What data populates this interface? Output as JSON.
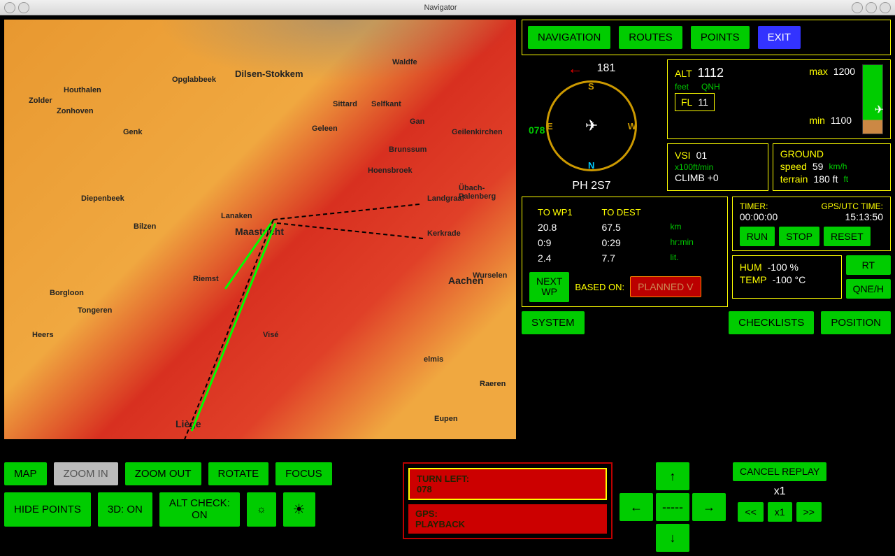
{
  "window": {
    "title": "Navigator"
  },
  "top_nav": {
    "navigation": "NAVIGATION",
    "routes": "ROUTES",
    "points": "POINTS",
    "exit": "EXIT"
  },
  "compass": {
    "heading": "181",
    "track": "078",
    "callsign": "PH 2S7",
    "n": "N",
    "s": "S",
    "e": "E",
    "w": "W"
  },
  "alt": {
    "label": "ALT",
    "value": "1112",
    "max_lbl": "max",
    "max": "1200",
    "min_lbl": "min",
    "min": "1100",
    "unit": "feet",
    "qnh": "QNH",
    "fl_lbl": "FL",
    "fl": "11"
  },
  "vsi": {
    "label": "VSI",
    "value": "01",
    "unit": "x100ft/min",
    "climb": "CLIMB +0"
  },
  "ground": {
    "label": "GROUND",
    "speed_lbl": "speed",
    "speed": "59",
    "speed_u": "km/h",
    "terrain_lbl": "terrain",
    "terrain": "180 ft",
    "terrain_u": "ft"
  },
  "wp": {
    "hdr1": "TO WP1",
    "hdr2": "TO DEST",
    "dist1": "20.8",
    "dist2": "67.5",
    "dist_u": "km",
    "time1": "0:9",
    "time2": "0:29",
    "time_u": "hr:min",
    "fuel1": "2.4",
    "fuel2": "7.7",
    "fuel_u": "lit.",
    "next": "NEXT\nWP",
    "based": "BASED ON:",
    "planned": "PLANNED V"
  },
  "timer": {
    "lbl": "TIMER:",
    "val": "00:00:00",
    "gps_lbl": "GPS/UTC TIME:",
    "gps_val": "15:13:50",
    "run": "RUN",
    "stop": "STOP",
    "reset": "RESET"
  },
  "env": {
    "hum_lbl": "HUM",
    "hum": "-100 %",
    "temp_lbl": "TEMP",
    "temp": "-100 °C",
    "rt": "RT",
    "qneh": "QNE/H"
  },
  "sys": {
    "system": "SYSTEM",
    "checklists": "CHECKLISTS",
    "position": "POSITION"
  },
  "map_btns": {
    "map": "MAP",
    "zoom_in": "ZOOM IN",
    "zoom_out": "ZOOM OUT",
    "rotate": "ROTATE",
    "focus": "FOCUS",
    "hide": "HIDE POINTS",
    "three_d": "3D: ON",
    "alt_check": "ALT CHECK:\nON"
  },
  "alerts": {
    "turn": "TURN LEFT:",
    "turn_hdg": "078",
    "gps": "GPS:",
    "gps_st": "PLAYBACK"
  },
  "arrows": {
    "up": "↑",
    "down": "↓",
    "left": "←",
    "right": "→",
    "center": "-----"
  },
  "replay": {
    "cancel": "CANCEL REPLAY",
    "speed": "x1",
    "rew": "<<",
    "play": "x1",
    "fwd": ">>"
  },
  "map_cities": {
    "maastricht": "Maastricht",
    "liege": "Liège",
    "aachen": "Aachen",
    "sittard": "Sittard",
    "dilsen": "Dilsen-Stokkem",
    "genk": "Genk",
    "tongeren": "Tongeren",
    "bilzen": "Bilzen",
    "geleen": "Geleen",
    "kerkrade": "Kerkrade",
    "vise": "Visé",
    "geilenkirchen": "Geilenkirchen",
    "hoensbroek": "Hoensbroek",
    "landgraaf": "Landgraaf",
    "brunssum": "Brunssum",
    "zonhoven": "Zonhoven",
    "houthalen": "Houthalen",
    "opglabbeek": "Opglabbeek",
    "zolder": "Zolder",
    "selfkant": "Selfkant",
    "wurselen": "Wurselen",
    "eupen": "Eupen",
    "raeren": "Raeren",
    "borgloon": "Borgloon",
    "riemst": "Riemst",
    "heers": "Heers",
    "lanaken": "Lanaken",
    "ubach": "Übach-Palenberg",
    "diepenbeek": "Diepenbeek",
    "waldfe": "Waldfe",
    "gan": "Gan",
    "elmis": "elmis"
  }
}
